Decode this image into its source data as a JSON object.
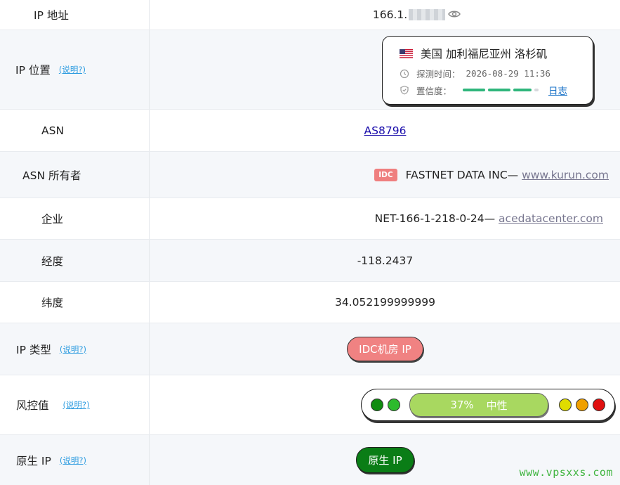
{
  "rows": {
    "ip": {
      "label": "IP 地址",
      "value_prefix": "166.1."
    },
    "location": {
      "label": "IP 位置",
      "explain": "(说明?)",
      "country_place": "美国 加利福尼亚州 洛杉矶",
      "detect_label": "探测时间：",
      "detect_time": "2026-08-29 11:36",
      "confidence_label": "置信度：",
      "confidence_level": 0.85,
      "log_link": "日志"
    },
    "asn": {
      "label": "ASN",
      "value": "AS8796"
    },
    "asn_owner": {
      "label": "ASN 所有者",
      "badge": "IDC",
      "name": "FASTNET DATA INC— ",
      "domain": "www.kurun.com"
    },
    "enterprise": {
      "label": "企业",
      "name": "NET-166-1-218-0-24— ",
      "domain": "acedatacenter.com"
    },
    "longitude": {
      "label": "经度",
      "value": "-118.2437"
    },
    "latitude": {
      "label": "纬度",
      "value": "34.052199999999"
    },
    "ip_type": {
      "label": "IP 类型",
      "explain": "(说明?)",
      "value": "IDC机房 IP"
    },
    "risk": {
      "label": "风控值",
      "explain": "(说明?)",
      "percent": "37%",
      "level": "中性"
    },
    "native": {
      "label": "原生 IP",
      "explain": "(说明?)",
      "value": "原生 IP"
    }
  },
  "colors": {
    "risk_dots": [
      "#118c11",
      "#2dbb2d",
      "#e0dc00",
      "#f0a000",
      "#e01010"
    ],
    "risk_fill": "#a8d860"
  },
  "icons": {
    "flag": "us-flag-icon",
    "eye": "eye-icon",
    "clock": "clock-icon",
    "shield": "shield-check-icon"
  },
  "watermark": "www.vpsxxs.com"
}
